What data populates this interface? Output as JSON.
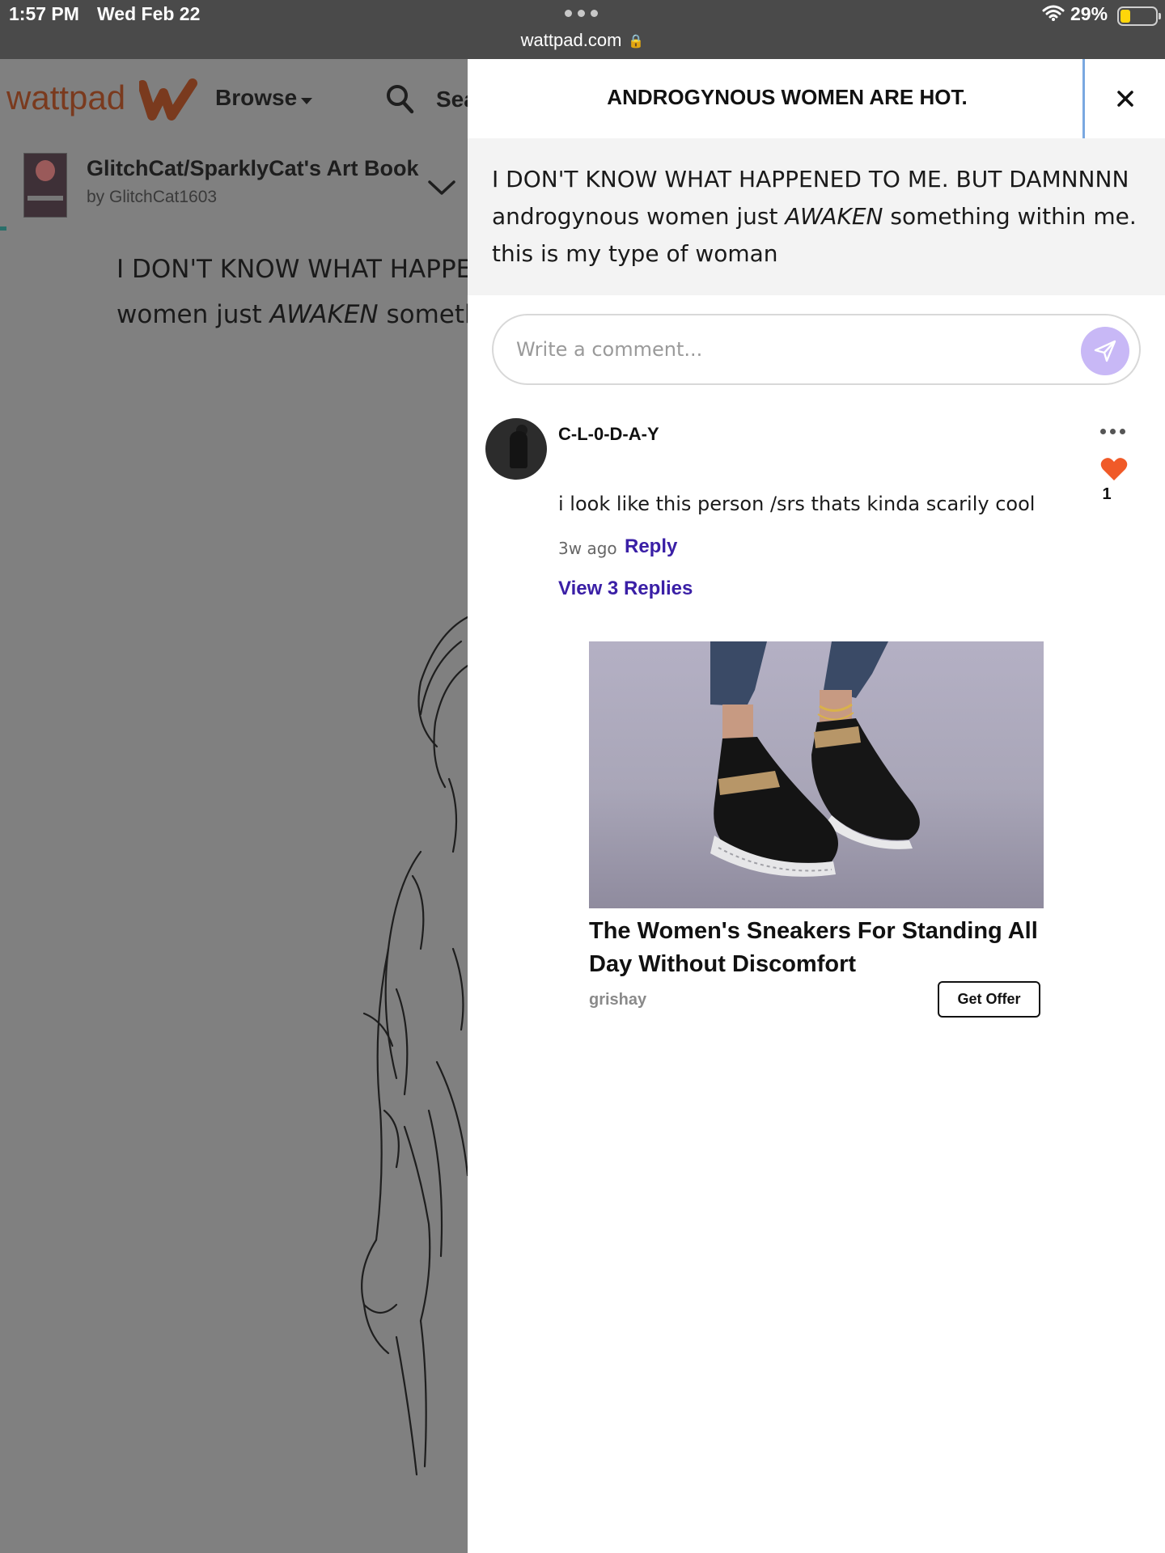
{
  "status_bar": {
    "time": "1:57 PM",
    "date": "Wed Feb 22",
    "url": "wattpad.com",
    "battery_percent": "29%",
    "battery_level": 0.29
  },
  "background_page": {
    "logo": "wattpad",
    "browse_label": "Browse",
    "search_label": "Sea",
    "story": {
      "title": "GlitchCat/SparklyCat's Art Book",
      "author": "by GlitchCat1603"
    },
    "text_line_1": "I DON'T KNOW WHAT HAPPENE",
    "text_line_2_pre": "women just ",
    "text_line_2_em": "AWAKEN",
    "text_line_2_post": " somethin"
  },
  "panel": {
    "title": "ANDROGYNOUS WOMEN ARE HOT.",
    "quote_pre": "I DON'T KNOW WHAT HAPPENED TO ME. BUT DAMNNNN androgynous women just ",
    "quote_em": "AWAKEN",
    "quote_post": " something within me. this is my type of woman",
    "comment_placeholder": "Write a comment...",
    "comment": {
      "username": "C-L-0-D-A-Y",
      "text": "i look like this person /srs thats kinda scarily cool",
      "time": "3w ago",
      "reply_label": "Reply",
      "likes": "1",
      "view_replies_label": "View 3 Replies"
    },
    "ad": {
      "title": "The Women's Sneakers For Standing All Day Without Discomfort",
      "source": "grishay",
      "cta": "Get Offer"
    }
  },
  "colors": {
    "brand": "#7a3a1e",
    "link": "#3a1fa6",
    "heart": "#f05a28",
    "send_button": "#c8b8f6",
    "overlay": "#808080"
  }
}
